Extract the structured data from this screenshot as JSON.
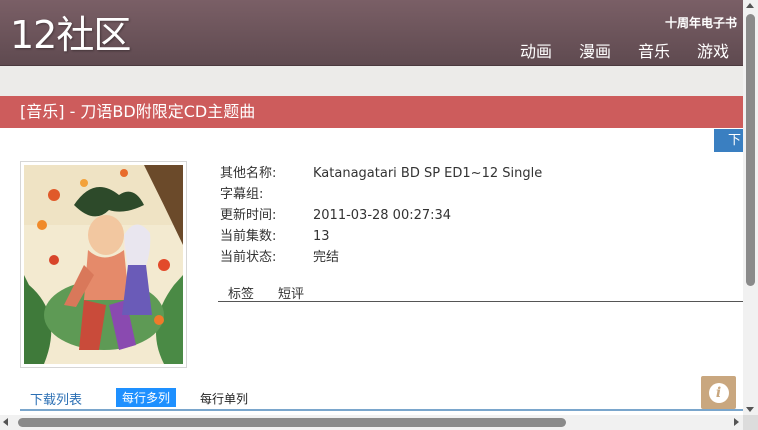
{
  "header": {
    "logo": "12社区",
    "promo": "十周年电子书",
    "nav": [
      "动画",
      "漫画",
      "音乐",
      "游戏"
    ]
  },
  "page": {
    "title": "[音乐] - 刀语BD附限定CD主题曲",
    "download_tab": "下"
  },
  "info": [
    {
      "label": "其他名称:",
      "value": "Katanagatari BD SP ED1~12 Single"
    },
    {
      "label": "字幕组:",
      "value": ""
    },
    {
      "label": "更新时间:",
      "value": "2011-03-28 00:27:34"
    },
    {
      "label": "当前集数:",
      "value": "13"
    },
    {
      "label": "当前状态:",
      "value": "完结"
    }
  ],
  "tabs": [
    "标签",
    "短评"
  ],
  "list": {
    "label": "下载列表",
    "multi": "每行多列",
    "single": "每行单列"
  },
  "info_icon": "i",
  "colors": {
    "header": "#6d565c",
    "title_bar": "#cd5c5c",
    "accent_blue": "#1e90ff"
  }
}
